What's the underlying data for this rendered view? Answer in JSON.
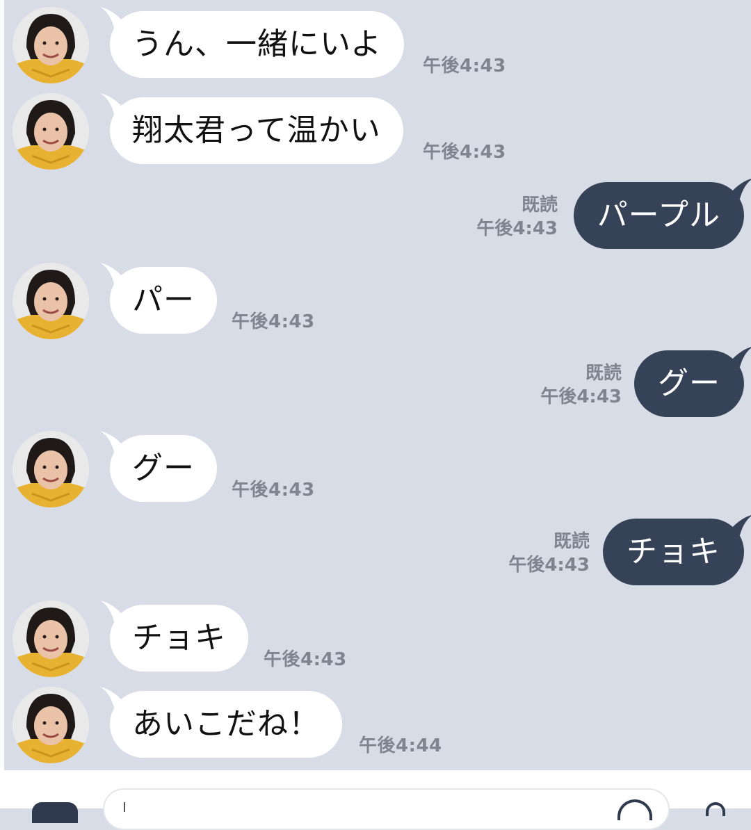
{
  "messages": [
    {
      "dir": "in",
      "text": "うん、一緒にいよ",
      "time": "午後4:43"
    },
    {
      "dir": "in",
      "text": "翔太君って温かい",
      "time": "午後4:43"
    },
    {
      "dir": "out",
      "text": "パープル",
      "read": "既読",
      "time": "午後4:43"
    },
    {
      "dir": "in",
      "text": "パー",
      "time": "午後4:43"
    },
    {
      "dir": "out",
      "text": "グー",
      "read": "既読",
      "time": "午後4:43"
    },
    {
      "dir": "in",
      "text": "グー",
      "time": "午後4:43"
    },
    {
      "dir": "out",
      "text": "チョキ",
      "read": "既読",
      "time": "午後4:43"
    },
    {
      "dir": "in",
      "text": "チョキ",
      "time": "午後4:43"
    },
    {
      "dir": "in",
      "text": "あいこだね！",
      "time": "午後4:44"
    }
  ],
  "composer": {
    "input_value": "",
    "icons": [
      "plus-icon",
      "emoji-icon",
      "mic-icon"
    ]
  },
  "colors": {
    "background": "#d7dce6",
    "incoming_bubble": "#ffffff",
    "outgoing_bubble": "#364257",
    "timestamp": "#7e8590"
  }
}
